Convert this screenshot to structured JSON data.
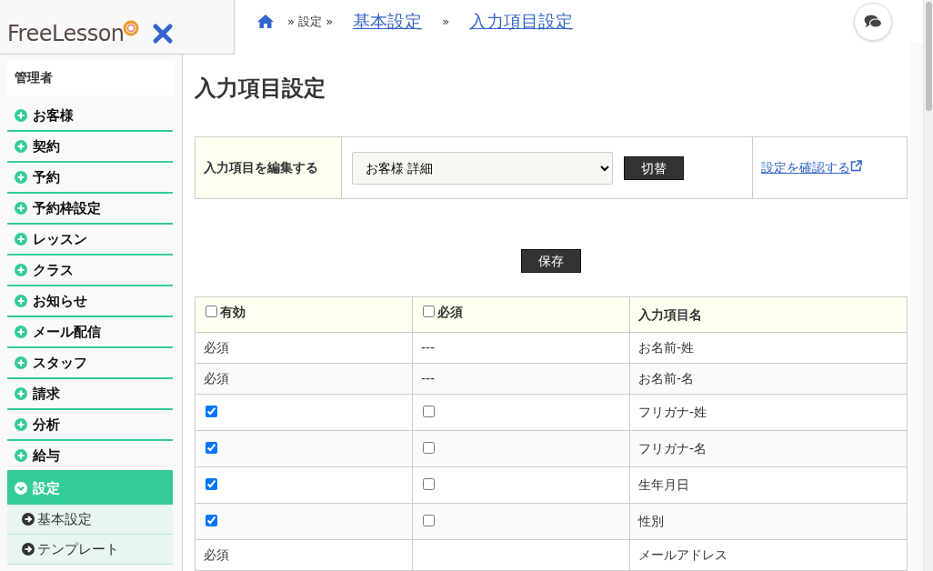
{
  "logo": {
    "text": "FreeLesson"
  },
  "breadcrumb": [
    {
      "label": "» 設定 »",
      "link": false
    },
    {
      "label": "基本設定",
      "link": true
    },
    {
      "label": "»",
      "link": false
    },
    {
      "label": "入力項目設定",
      "link": true
    }
  ],
  "sidebar": {
    "role": "管理者",
    "items": [
      {
        "label": "お客様",
        "expanded": false
      },
      {
        "label": "契約",
        "expanded": false
      },
      {
        "label": "予約",
        "expanded": false
      },
      {
        "label": "予約枠設定",
        "expanded": false
      },
      {
        "label": "レッスン",
        "expanded": false
      },
      {
        "label": "クラス",
        "expanded": false
      },
      {
        "label": "お知らせ",
        "expanded": false
      },
      {
        "label": "メール配信",
        "expanded": false
      },
      {
        "label": "スタッフ",
        "expanded": false
      },
      {
        "label": "請求",
        "expanded": false
      },
      {
        "label": "分析",
        "expanded": false
      },
      {
        "label": "給与",
        "expanded": false
      },
      {
        "label": "設定",
        "expanded": true,
        "children": [
          {
            "label": "基本設定"
          },
          {
            "label": "テンプレート"
          }
        ]
      }
    ]
  },
  "page_title": "入力項目設定",
  "editor": {
    "label": "入力項目を編集する",
    "select_value": "お客様 詳細",
    "switch_button": "切替",
    "check_link": "設定を確認する"
  },
  "save_button": "保存",
  "table": {
    "columns": [
      {
        "label": "有効",
        "checked": false
      },
      {
        "label": "必須",
        "checked": false
      },
      {
        "label": "入力項目名"
      }
    ],
    "rows": [
      {
        "kind": "fixed",
        "enabled_text": "必須",
        "required_text": "---",
        "name": "お名前-姓"
      },
      {
        "kind": "fixed",
        "enabled_text": "必須",
        "required_text": "---",
        "name": "お名前-名"
      },
      {
        "kind": "toggle",
        "enabled": true,
        "required": false,
        "name": "フリガナ-姓"
      },
      {
        "kind": "toggle",
        "enabled": true,
        "required": false,
        "name": "フリガナ-名"
      },
      {
        "kind": "toggle",
        "enabled": true,
        "required": false,
        "name": "生年月日"
      },
      {
        "kind": "toggle",
        "enabled": true,
        "required": false,
        "name": "性別"
      },
      {
        "kind": "fixed",
        "enabled_text": "必須",
        "name": "メールアドレス"
      }
    ]
  }
}
